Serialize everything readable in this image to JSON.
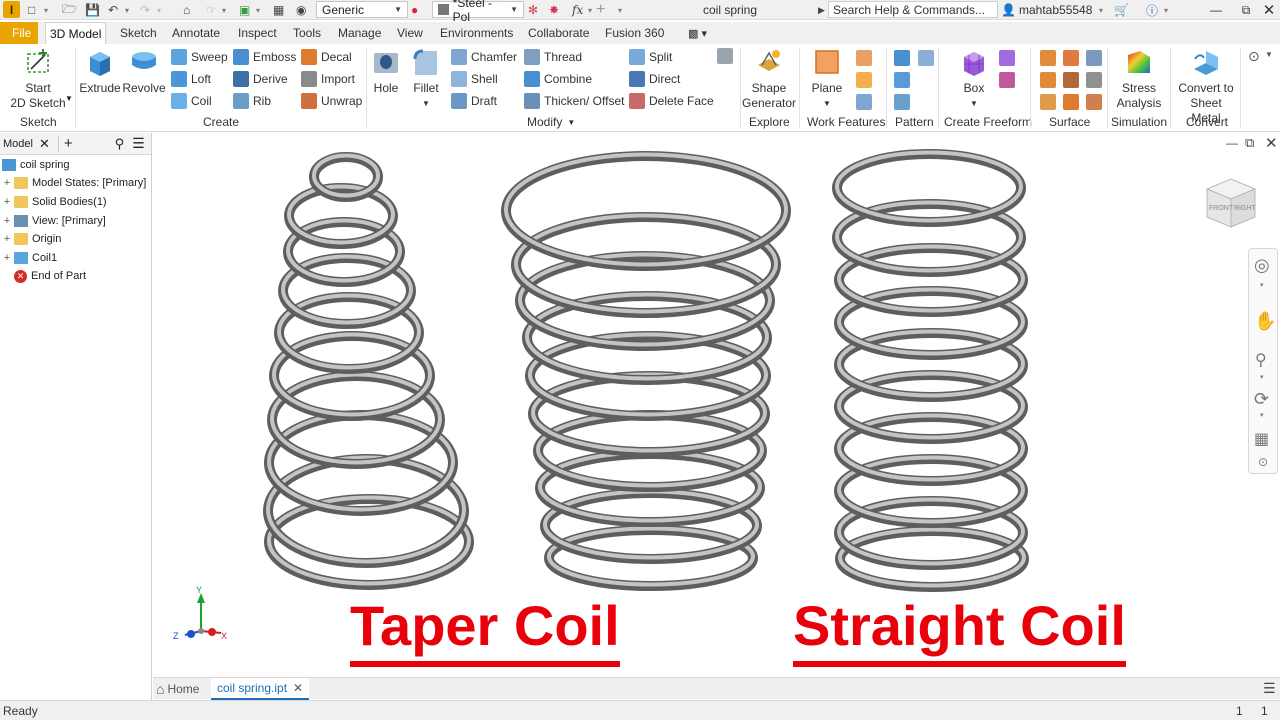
{
  "titlebar": {
    "app_logo": "I",
    "material": "Generic",
    "appearance": "*Steel - Pol",
    "document_title": "coil spring",
    "search_placeholder": "Search Help & Commands...",
    "username": "mahtab55548"
  },
  "tabs": [
    {
      "label": "File"
    },
    {
      "label": "3D Model"
    },
    {
      "label": "Sketch"
    },
    {
      "label": "Annotate"
    },
    {
      "label": "Inspect"
    },
    {
      "label": "Tools"
    },
    {
      "label": "Manage"
    },
    {
      "label": "View"
    },
    {
      "label": "Environments"
    },
    {
      "label": "Collaborate"
    },
    {
      "label": "Fusion 360"
    }
  ],
  "ribbon": {
    "sketch": {
      "start": "Start",
      "sketch2d": "2D Sketch",
      "label": "Sketch"
    },
    "create": {
      "extrude": "Extrude",
      "revolve": "Revolve",
      "sweep": "Sweep",
      "loft": "Loft",
      "coil": "Coil",
      "emboss": "Emboss",
      "derive": "Derive",
      "rib": "Rib",
      "decal": "Decal",
      "import": "Import",
      "unwrap": "Unwrap",
      "label": "Create"
    },
    "modify": {
      "hole": "Hole",
      "fillet": "Fillet",
      "chamfer": "Chamfer",
      "shell": "Shell",
      "draft": "Draft",
      "thread": "Thread",
      "combine": "Combine",
      "thicken": "Thicken/ Offset",
      "split": "Split",
      "direct": "Direct",
      "delete_face": "Delete Face",
      "label": "Modify"
    },
    "explore": {
      "shape1": "Shape",
      "shape2": "Generator",
      "label": "Explore"
    },
    "work_features": {
      "plane": "Plane",
      "label": "Work Features"
    },
    "pattern": {
      "label": "Pattern"
    },
    "freeform": {
      "box": "Box",
      "label": "Create Freeform"
    },
    "surface": {
      "label": "Surface"
    },
    "simulation": {
      "stress1": "Stress",
      "stress2": "Analysis",
      "label": "Simulation"
    },
    "convert": {
      "conv1": "Convert to",
      "conv2": "Sheet Metal",
      "label": "Convert"
    }
  },
  "browser": {
    "tab_label": "Model",
    "items": [
      {
        "label": "coil spring"
      },
      {
        "label": "Model States: [Primary]"
      },
      {
        "label": "Solid Bodies(1)"
      },
      {
        "label": "View: [Primary]"
      },
      {
        "label": "Origin"
      },
      {
        "label": "Coil1"
      },
      {
        "label": "End of Part"
      }
    ]
  },
  "viewport": {
    "viewcube_front": "FRONT",
    "viewcube_right": "RIGHT",
    "axis_x": "X",
    "axis_y": "Y",
    "axis_z": "Z",
    "caption_left": "Taper Coil",
    "caption_right": "Straight Coil",
    "caption_color": "#e8000b"
  },
  "doctabs": {
    "home": "Home",
    "file": "coil spring.ipt"
  },
  "status": {
    "text": "Ready",
    "num1": "1",
    "num2": "1"
  }
}
